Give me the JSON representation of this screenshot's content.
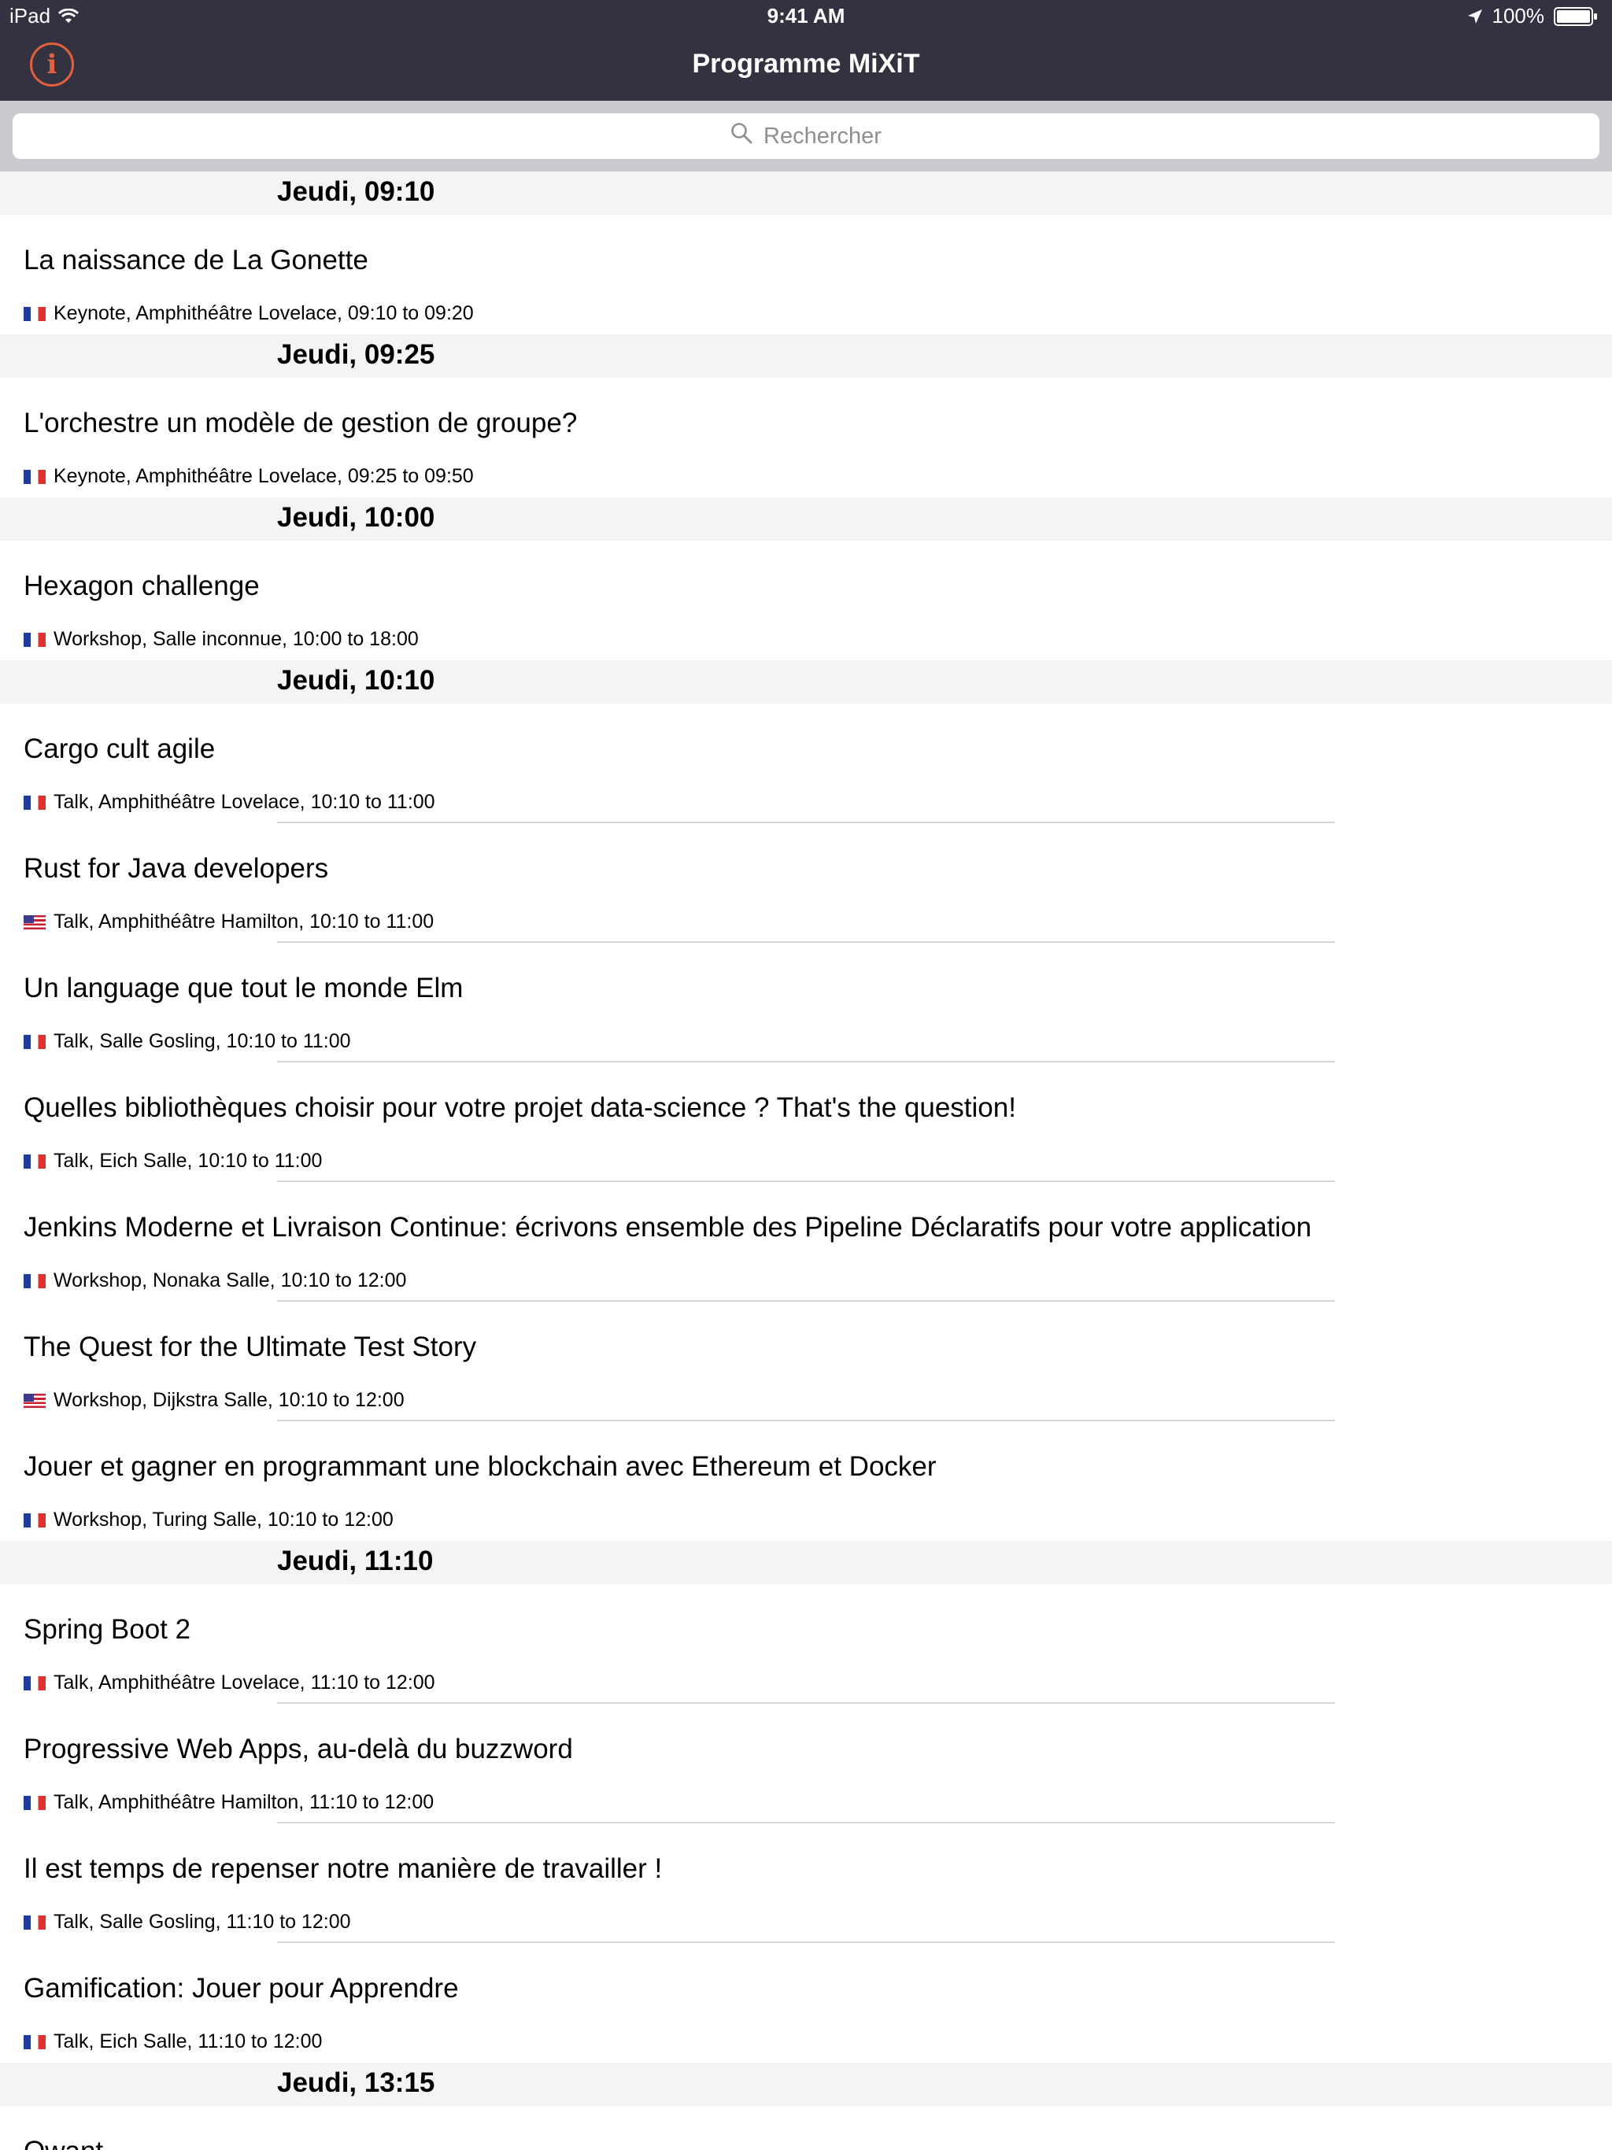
{
  "status_bar": {
    "device": "iPad",
    "time": "9:41 AM",
    "battery": "100%"
  },
  "nav": {
    "title": "Programme MiXiT",
    "info_icon": "info-icon",
    "info_glyph": "i",
    "accent_color": "#e2603b",
    "bar_color": "#343241"
  },
  "search": {
    "placeholder": "Rechercher"
  },
  "sections": [
    {
      "header": "Jeudi, 09:10",
      "items": [
        {
          "title": "La naissance de La Gonette",
          "flag": "fr",
          "meta": "Keynote, Amphithéâtre Lovelace, 09:10 to 09:20"
        }
      ]
    },
    {
      "header": "Jeudi, 09:25",
      "items": [
        {
          "title": "L'orchestre un modèle de gestion de groupe?",
          "flag": "fr",
          "meta": "Keynote, Amphithéâtre Lovelace, 09:25 to 09:50"
        }
      ]
    },
    {
      "header": "Jeudi, 10:00",
      "items": [
        {
          "title": "Hexagon challenge",
          "flag": "fr",
          "meta": "Workshop, Salle inconnue, 10:00 to 18:00"
        }
      ]
    },
    {
      "header": "Jeudi, 10:10",
      "items": [
        {
          "title": "Cargo cult agile",
          "flag": "fr",
          "meta": "Talk, Amphithéâtre Lovelace, 10:10 to 11:00"
        },
        {
          "title": "Rust for Java developers",
          "flag": "us",
          "meta": "Talk, Amphithéâtre Hamilton, 10:10 to 11:00"
        },
        {
          "title": "Un language que tout le monde Elm",
          "flag": "fr",
          "meta": "Talk, Salle Gosling, 10:10 to 11:00"
        },
        {
          "title": "Quelles bibliothèques choisir pour votre projet data-science ? That's the question!",
          "flag": "fr",
          "meta": "Talk, Eich Salle, 10:10 to 11:00"
        },
        {
          "title": "Jenkins Moderne et Livraison Continue: écrivons ensemble des Pipeline Déclaratifs pour votre application",
          "flag": "fr",
          "meta": "Workshop, Nonaka Salle, 10:10 to 12:00"
        },
        {
          "title": "The Quest for the Ultimate Test Story",
          "flag": "us",
          "meta": "Workshop, Dijkstra Salle, 10:10 to 12:00"
        },
        {
          "title": "Jouer et gagner en programmant une blockchain avec Ethereum et Docker",
          "flag": "fr",
          "meta": "Workshop, Turing Salle, 10:10 to 12:00"
        }
      ]
    },
    {
      "header": "Jeudi, 11:10",
      "items": [
        {
          "title": "Spring Boot 2",
          "flag": "fr",
          "meta": "Talk, Amphithéâtre Lovelace, 11:10 to 12:00"
        },
        {
          "title": "Progressive Web Apps, au-delà du buzzword",
          "flag": "fr",
          "meta": "Talk, Amphithéâtre Hamilton, 11:10 to 12:00"
        },
        {
          "title": "Il est temps de repenser notre manière de travailler !",
          "flag": "fr",
          "meta": "Talk, Salle Gosling, 11:10 to 12:00"
        },
        {
          "title": "Gamification: Jouer pour Apprendre",
          "flag": "fr",
          "meta": "Talk, Eich Salle, 11:10 to 12:00"
        }
      ]
    },
    {
      "header": "Jeudi, 13:15",
      "items": [
        {
          "title": "Qwant",
          "flag": "fr",
          "meta": ""
        }
      ]
    }
  ]
}
